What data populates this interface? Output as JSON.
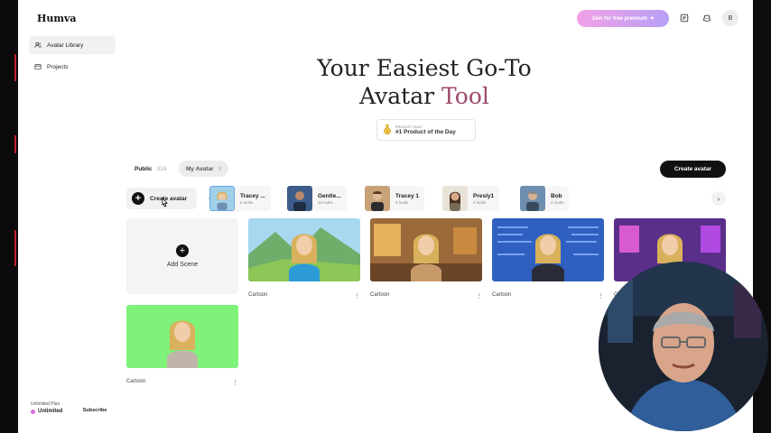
{
  "app": {
    "name": "Humva"
  },
  "sidebar": {
    "items": [
      {
        "label": "Avatar Library",
        "icon": "users-icon",
        "active": true
      },
      {
        "label": "Projects",
        "icon": "folder-icon",
        "active": false
      }
    ],
    "plan": {
      "title": "Unlimited Plan",
      "value": "Unlimited",
      "subscribe_label": "Subscribe"
    }
  },
  "header": {
    "join_label": "Join for free premium",
    "user_initial": "B"
  },
  "hero": {
    "line1": "Your Easiest Go-To",
    "line2_plain": "Avatar",
    "line2_accent": "Tool",
    "badge_small": "PRODUCT HUNT",
    "badge_big": "#1 Product of the Day"
  },
  "tabs": [
    {
      "label": "Public",
      "count": "319"
    },
    {
      "label": "My Avatar",
      "count": "9"
    }
  ],
  "create_avatar_label": "Create avatar",
  "strip": {
    "create_label": "Create avatar",
    "avatars": [
      {
        "name": "Tracey ...",
        "looks": "5 looks"
      },
      {
        "name": "Gentle...",
        "looks": "10 looks"
      },
      {
        "name": "Tracey 1",
        "looks": "5 looks"
      },
      {
        "name": "Presly1",
        "looks": "4 looks"
      },
      {
        "name": "Bob",
        "looks": "4 looks"
      }
    ]
  },
  "scenes": {
    "add_label": "Add Scene",
    "cards": [
      {
        "label": "Cartoon",
        "more": "⋮"
      },
      {
        "label": "Cartoon",
        "more": "⋮"
      },
      {
        "label": "Cartoon",
        "more": "⋮"
      },
      {
        "label": "C",
        "more": ""
      },
      {
        "label": "Cartoon",
        "more": "⋮"
      }
    ]
  },
  "colors": {
    "accent_title": "#9d4a6d",
    "join_gradient_start": "#f2a1e6",
    "join_gradient_end": "#b79ff5",
    "primary_button": "#111111",
    "green_screen": "#7ff27a"
  }
}
